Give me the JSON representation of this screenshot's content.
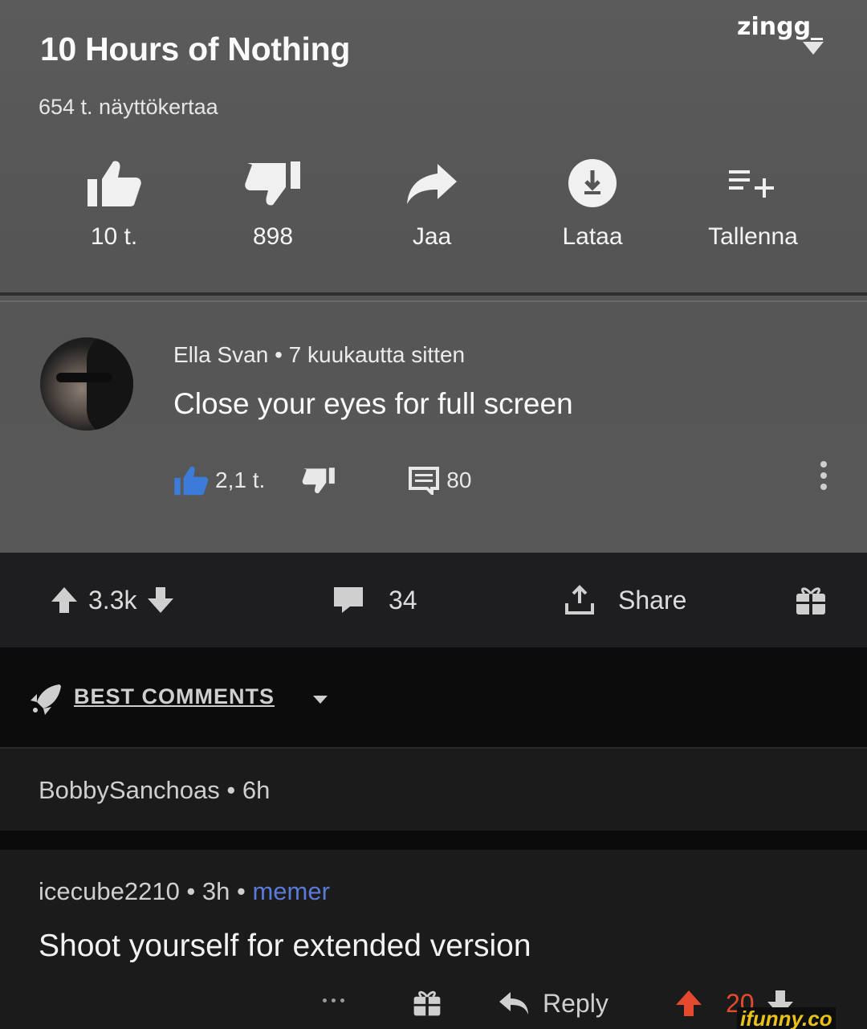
{
  "youtube": {
    "title": "10 Hours of Nothing",
    "views": "654 t. näyttökertaa",
    "watermark": "zingg_",
    "actions": [
      {
        "icon": "thumbs-up-icon",
        "label": "10 t."
      },
      {
        "icon": "thumbs-down-icon",
        "label": "898"
      },
      {
        "icon": "share-arrow-icon",
        "label": "Jaa"
      },
      {
        "icon": "download-icon",
        "label": "Lataa"
      },
      {
        "icon": "add-to-playlist-icon",
        "label": "Tallenna"
      }
    ],
    "comment": {
      "author_meta": "Ella Svan • 7 kuukautta sitten",
      "text": "Close your eyes for full screen",
      "likes": "2,1 t.",
      "replies": "80",
      "like_color": "#3d7bd8"
    }
  },
  "post_bar": {
    "upvotes": "3.3k",
    "comments": "34",
    "share_label": "Share"
  },
  "best_comments_label": "BEST COMMENTS",
  "comments": [
    {
      "meta": "BobbySanchoas • 6h"
    },
    {
      "author_meta": "icecube2210 • 3h • ",
      "badge": "memer",
      "text": "Shoot yourself for extended version",
      "reply_label": "Reply",
      "score": "20",
      "score_color": "#e64a2e"
    }
  ],
  "badge_color": "#5b7ad8",
  "site_watermark": "ifunny.co"
}
